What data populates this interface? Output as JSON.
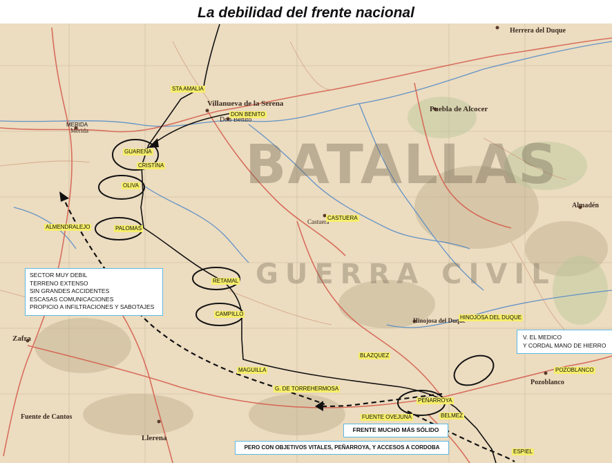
{
  "title": "La debilidad del frente nacional",
  "colors": {
    "map_bg": "#ecdcc0",
    "road": "#d45a4a",
    "river": "#4a86c8",
    "front": "#111111",
    "label_bg": "#f6ee6a",
    "box_border": "#5bb9e8"
  },
  "yellow_labels": [
    {
      "id": "sta-amalia",
      "text": "STA AMALIA"
    },
    {
      "id": "don-benito",
      "text": "DON BENITO"
    },
    {
      "id": "guarena",
      "text": "GUAREÑA"
    },
    {
      "id": "cristina",
      "text": "CRISTINA"
    },
    {
      "id": "oliva",
      "text": "OLIVA"
    },
    {
      "id": "almendralejo",
      "text": "ALMENDRALEJO"
    },
    {
      "id": "palomas",
      "text": "PALOMAS"
    },
    {
      "id": "castuera",
      "text": "CASTUERA"
    },
    {
      "id": "retamal",
      "text": "RETAMAL"
    },
    {
      "id": "campillo",
      "text": "CAMPILLO"
    },
    {
      "id": "hinojosa",
      "text": "HINOJOSA DEL DUQUE"
    },
    {
      "id": "blazquez",
      "text": "BLAZQUEZ"
    },
    {
      "id": "maguilla",
      "text": "MAGUILLA"
    },
    {
      "id": "torrehermosa",
      "text": "G. DE TORREHERMOSA"
    },
    {
      "id": "penarroya",
      "text": "PEÑARROYA"
    },
    {
      "id": "belmez",
      "text": "BELMEZ"
    },
    {
      "id": "fuente-ovejuna",
      "text": "FUENTE OVEJUNA"
    },
    {
      "id": "pozoblanco-label",
      "text": "POZOBLANCO"
    },
    {
      "id": "espiel",
      "text": "ESPIEL"
    }
  ],
  "map_towns": [
    {
      "id": "villanueva",
      "text": "Villanueva de la Serena"
    },
    {
      "id": "don-benito-town",
      "text": "Don Benito"
    },
    {
      "id": "merida",
      "text": "Mérida"
    },
    {
      "id": "merida-label",
      "text": "MERIDA"
    },
    {
      "id": "puebla-alcocer",
      "text": "Puebla de Alcocer"
    },
    {
      "id": "herrera",
      "text": "Herrera del Duque"
    },
    {
      "id": "almaden",
      "text": "Almadén"
    },
    {
      "id": "zafra",
      "text": "Zafra"
    },
    {
      "id": "llerena",
      "text": "Llerena"
    },
    {
      "id": "fuente-cantos",
      "text": "Fuente de Cantos"
    },
    {
      "id": "pozoblanco-town",
      "text": "Pozoblanco"
    },
    {
      "id": "hinojosa-town",
      "text": "Hinojosa del Duque"
    },
    {
      "id": "castuera-town",
      "text": "Castuera"
    }
  ],
  "watermark": {
    "line1": "BATALLAS",
    "line2": "GUERRA CIVIL"
  },
  "notes": {
    "weak_sector": [
      "SECTOR MUY DEBIL",
      "TERRENO EXTENSO",
      "SIN GRANDES ACCIDENTES",
      "ESCASAS COMUNICACIONES",
      "PROPICIO A INFILTRACIONES Y SABOTAJES"
    ],
    "medico": [
      "V. EL MEDICO",
      "Y CORDAL MANO DE HIERRO"
    ],
    "solid_front": "FRENTE MUCHO MÁS SÓLIDO",
    "objectives": "PERO CON OBJETIVOS VITALES, PEÑARROYA, Y ACCESOS A CORDOBA"
  }
}
